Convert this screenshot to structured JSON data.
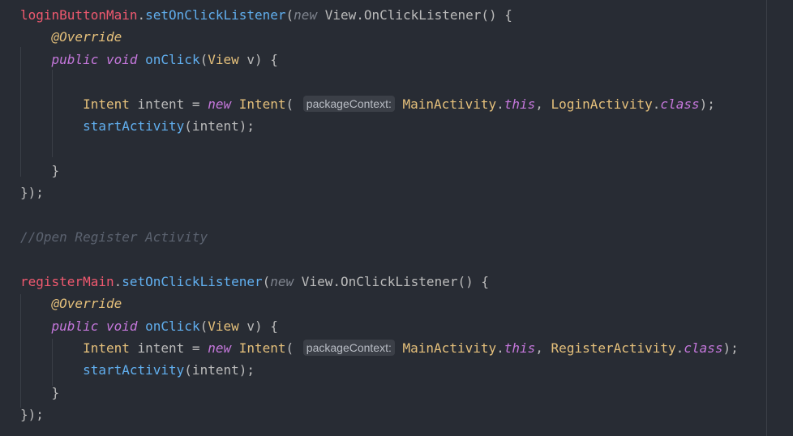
{
  "editor": {
    "theme": {
      "background": "#282c34"
    },
    "lines": [
      [
        {
          "t": "loginButtonMain",
          "c": "field"
        },
        {
          "t": ".",
          "c": "punct"
        },
        {
          "t": "setOnClickListener",
          "c": "method"
        },
        {
          "t": "(",
          "c": "punct"
        },
        {
          "t": "new",
          "c": "italic"
        },
        {
          "t": " View.OnClickListener() {",
          "c": "punct"
        }
      ],
      [
        {
          "t": "    ",
          "c": "punct"
        },
        {
          "t": "@Override",
          "c": "ann"
        }
      ],
      [
        {
          "t": "    ",
          "c": "punct"
        },
        {
          "t": "public",
          "c": "kwi"
        },
        {
          "t": " ",
          "c": "punct"
        },
        {
          "t": "void",
          "c": "kwi"
        },
        {
          "t": " ",
          "c": "punct"
        },
        {
          "t": "onClick",
          "c": "method"
        },
        {
          "t": "(",
          "c": "punct"
        },
        {
          "t": "View",
          "c": "cls"
        },
        {
          "t": " v) {",
          "c": "punct"
        }
      ],
      [],
      [
        {
          "t": "        ",
          "c": "punct"
        },
        {
          "t": "Intent",
          "c": "cls"
        },
        {
          "t": " intent = ",
          "c": "punct"
        },
        {
          "t": "new",
          "c": "kwi"
        },
        {
          "t": " ",
          "c": "punct"
        },
        {
          "t": "Intent",
          "c": "cls"
        },
        {
          "t": "( ",
          "c": "punct"
        },
        {
          "hint": "packageContext:"
        },
        {
          "t": " ",
          "c": "punct"
        },
        {
          "t": "MainActivity",
          "c": "cls"
        },
        {
          "t": ".",
          "c": "punct"
        },
        {
          "t": "this",
          "c": "kwi"
        },
        {
          "t": ", ",
          "c": "punct"
        },
        {
          "t": "LoginActivity",
          "c": "cls"
        },
        {
          "t": ".",
          "c": "punct"
        },
        {
          "t": "class",
          "c": "kwi"
        },
        {
          "t": ");",
          "c": "punct"
        }
      ],
      [
        {
          "t": "        ",
          "c": "punct"
        },
        {
          "t": "startActivity",
          "c": "method"
        },
        {
          "t": "(intent);",
          "c": "punct"
        }
      ],
      [],
      [
        {
          "t": "    }",
          "c": "punct"
        }
      ],
      [
        {
          "t": "});",
          "c": "punct"
        }
      ],
      [],
      [
        {
          "t": "//Open Register Activity",
          "c": "cmt"
        }
      ],
      [],
      [
        {
          "t": "registerMain",
          "c": "field"
        },
        {
          "t": ".",
          "c": "punct"
        },
        {
          "t": "setOnClickListener",
          "c": "method"
        },
        {
          "t": "(",
          "c": "punct"
        },
        {
          "t": "new",
          "c": "italic"
        },
        {
          "t": " View.OnClickListener() {",
          "c": "punct"
        }
      ],
      [
        {
          "t": "    ",
          "c": "punct"
        },
        {
          "t": "@Override",
          "c": "ann"
        }
      ],
      [
        {
          "t": "    ",
          "c": "punct"
        },
        {
          "t": "public",
          "c": "kwi"
        },
        {
          "t": " ",
          "c": "punct"
        },
        {
          "t": "void",
          "c": "kwi"
        },
        {
          "t": " ",
          "c": "punct"
        },
        {
          "t": "onClick",
          "c": "method"
        },
        {
          "t": "(",
          "c": "punct"
        },
        {
          "t": "View",
          "c": "cls"
        },
        {
          "t": " v) {",
          "c": "punct"
        }
      ],
      [
        {
          "t": "        ",
          "c": "punct"
        },
        {
          "t": "Intent",
          "c": "cls"
        },
        {
          "t": " intent = ",
          "c": "punct"
        },
        {
          "t": "new",
          "c": "kwi"
        },
        {
          "t": " ",
          "c": "punct"
        },
        {
          "t": "Intent",
          "c": "cls"
        },
        {
          "t": "( ",
          "c": "punct"
        },
        {
          "hint": "packageContext:"
        },
        {
          "t": " ",
          "c": "punct"
        },
        {
          "t": "MainActivity",
          "c": "cls"
        },
        {
          "t": ".",
          "c": "punct"
        },
        {
          "t": "this",
          "c": "kwi"
        },
        {
          "t": ", ",
          "c": "punct"
        },
        {
          "t": "RegisterActivity",
          "c": "cls"
        },
        {
          "t": ".",
          "c": "punct"
        },
        {
          "t": "class",
          "c": "kwi"
        },
        {
          "t": ");",
          "c": "punct"
        }
      ],
      [
        {
          "t": "        ",
          "c": "punct"
        },
        {
          "t": "startActivity",
          "c": "method"
        },
        {
          "t": "(intent);",
          "c": "punct"
        }
      ],
      [
        {
          "t": "    }",
          "c": "punct"
        }
      ],
      [
        {
          "t": "});",
          "c": "punct"
        }
      ]
    ]
  }
}
